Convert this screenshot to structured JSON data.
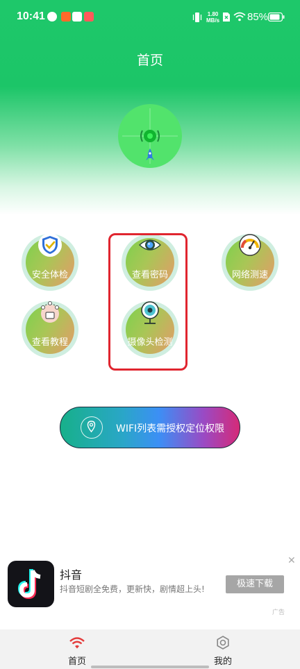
{
  "status_bar": {
    "time": "10:41",
    "net_speed_value": "1.80",
    "net_speed_unit": "MB/s",
    "battery": "85%"
  },
  "page": {
    "title": "首页"
  },
  "tiles": [
    {
      "label": "安全体检",
      "icon": "shield-check-icon"
    },
    {
      "label": "查看密码",
      "icon": "eye-icon"
    },
    {
      "label": "网络测速",
      "icon": "speedometer-icon"
    },
    {
      "label": "查看教程",
      "icon": "tutorial-icon"
    },
    {
      "label": "摄像头检测",
      "icon": "camera-icon"
    }
  ],
  "wifi_button": {
    "label": "WIFI列表需授权定位权限",
    "icon": "location-pin-icon"
  },
  "ad": {
    "app_name": "抖音",
    "description": "抖音短剧全免费，更新快，剧情超上头!",
    "download_label": "极速下载",
    "close_symbol": "✕",
    "tag": "广告"
  },
  "tabbar": {
    "tabs": [
      {
        "label": "首页",
        "icon": "wifi-icon",
        "active": true
      },
      {
        "label": "我的",
        "icon": "settings-icon",
        "active": false
      }
    ]
  },
  "colors": {
    "header_green": "#1ec86a",
    "highlight_red": "#e0252f",
    "tile_gradient_start": "#7ed04d",
    "tile_gradient_end": "#e59a69"
  }
}
